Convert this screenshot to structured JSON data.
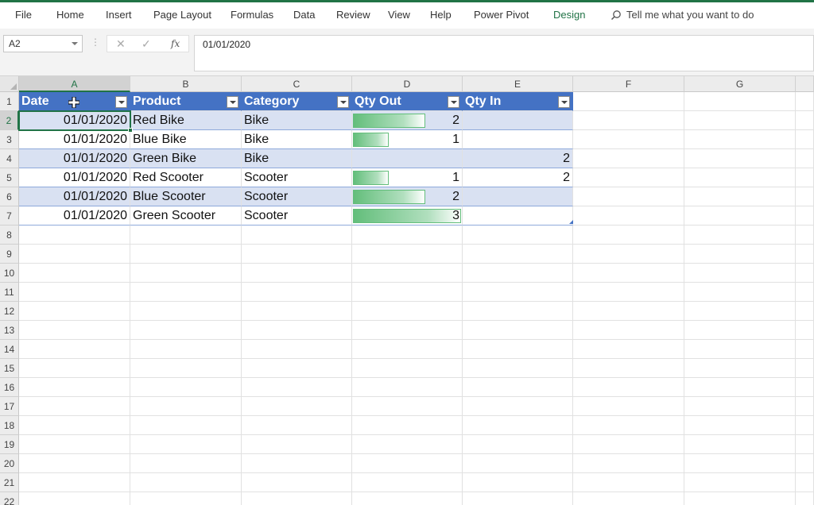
{
  "ribbon": {
    "tabs": [
      "File",
      "Home",
      "Insert",
      "Page Layout",
      "Formulas",
      "Data",
      "Review",
      "View",
      "Help",
      "Power Pivot",
      "Design"
    ],
    "tell_me": "Tell me what you want to do",
    "accent_color": "#217346"
  },
  "formula_bar": {
    "name_box": "A2",
    "formula": "01/01/2020",
    "icons": [
      "cancel-icon",
      "enter-icon",
      "function-icon"
    ],
    "fx_label": "fx"
  },
  "grid": {
    "columns": [
      "A",
      "B",
      "C",
      "D",
      "E",
      "F",
      "G"
    ],
    "rows": [
      "1",
      "2",
      "3",
      "4",
      "5",
      "6",
      "7",
      "8",
      "9",
      "10",
      "11",
      "12",
      "13",
      "14",
      "15",
      "16",
      "17",
      "18",
      "19",
      "20",
      "21",
      "22"
    ],
    "active_cell": "A2"
  },
  "table": {
    "header_color": "#4472c4",
    "band_color": "#d9e1f2",
    "databar_color": "#63be7b",
    "headers": [
      "Date",
      "Product",
      "Category",
      "Qty Out",
      "Qty In"
    ],
    "rows": [
      {
        "date": "01/01/2020",
        "product": "Red Bike",
        "category": "Bike",
        "qty_out": "2",
        "qty_in": "",
        "qty_out_bar": 2
      },
      {
        "date": "01/01/2020",
        "product": "Blue Bike",
        "category": "Bike",
        "qty_out": "1",
        "qty_in": "",
        "qty_out_bar": 1
      },
      {
        "date": "01/01/2020",
        "product": "Green Bike",
        "category": "Bike",
        "qty_out": "",
        "qty_in": "2",
        "qty_out_bar": 0
      },
      {
        "date": "01/01/2020",
        "product": "Red Scooter",
        "category": "Scooter",
        "qty_out": "1",
        "qty_in": "2",
        "qty_out_bar": 1
      },
      {
        "date": "01/01/2020",
        "product": "Blue Scooter",
        "category": "Scooter",
        "qty_out": "2",
        "qty_in": "",
        "qty_out_bar": 2
      },
      {
        "date": "01/01/2020",
        "product": "Green Scooter",
        "category": "Scooter",
        "qty_out": "3",
        "qty_in": "",
        "qty_out_bar": 3
      }
    ],
    "databar_max": 3
  }
}
